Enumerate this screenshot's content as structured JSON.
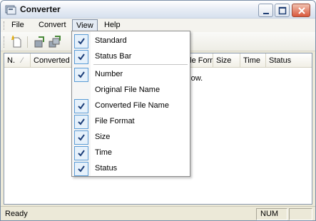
{
  "window": {
    "title": "Converter",
    "buttons": [
      "minimize",
      "maximize",
      "close"
    ]
  },
  "menubar": {
    "items": [
      {
        "label": "File",
        "active": false
      },
      {
        "label": "Convert",
        "active": false
      },
      {
        "label": "View",
        "active": true
      },
      {
        "label": "Help",
        "active": false
      }
    ]
  },
  "toolbar": {
    "buttons": [
      "new-icon",
      "convert-icon",
      "convert-all-icon"
    ]
  },
  "list": {
    "columns": [
      "N.",
      "Converted File Name",
      "File Format",
      "Size",
      "Time",
      "Status"
    ],
    "empty_message": "show."
  },
  "view_menu": {
    "items": [
      {
        "label": "Standard",
        "checked": true
      },
      {
        "label": "Status Bar",
        "checked": true
      },
      {
        "label": "Number",
        "checked": true
      },
      {
        "label": "Original File Name",
        "checked": false
      },
      {
        "label": "Converted File Name",
        "checked": true
      },
      {
        "label": "File Format",
        "checked": true
      },
      {
        "label": "Size",
        "checked": true
      },
      {
        "label": "Time",
        "checked": true
      },
      {
        "label": "Status",
        "checked": true
      }
    ]
  },
  "statusbar": {
    "status": "Ready",
    "indicator": "NUM"
  },
  "colors": {
    "accent": "#5a9bd5",
    "close_button": "#d9583c"
  }
}
